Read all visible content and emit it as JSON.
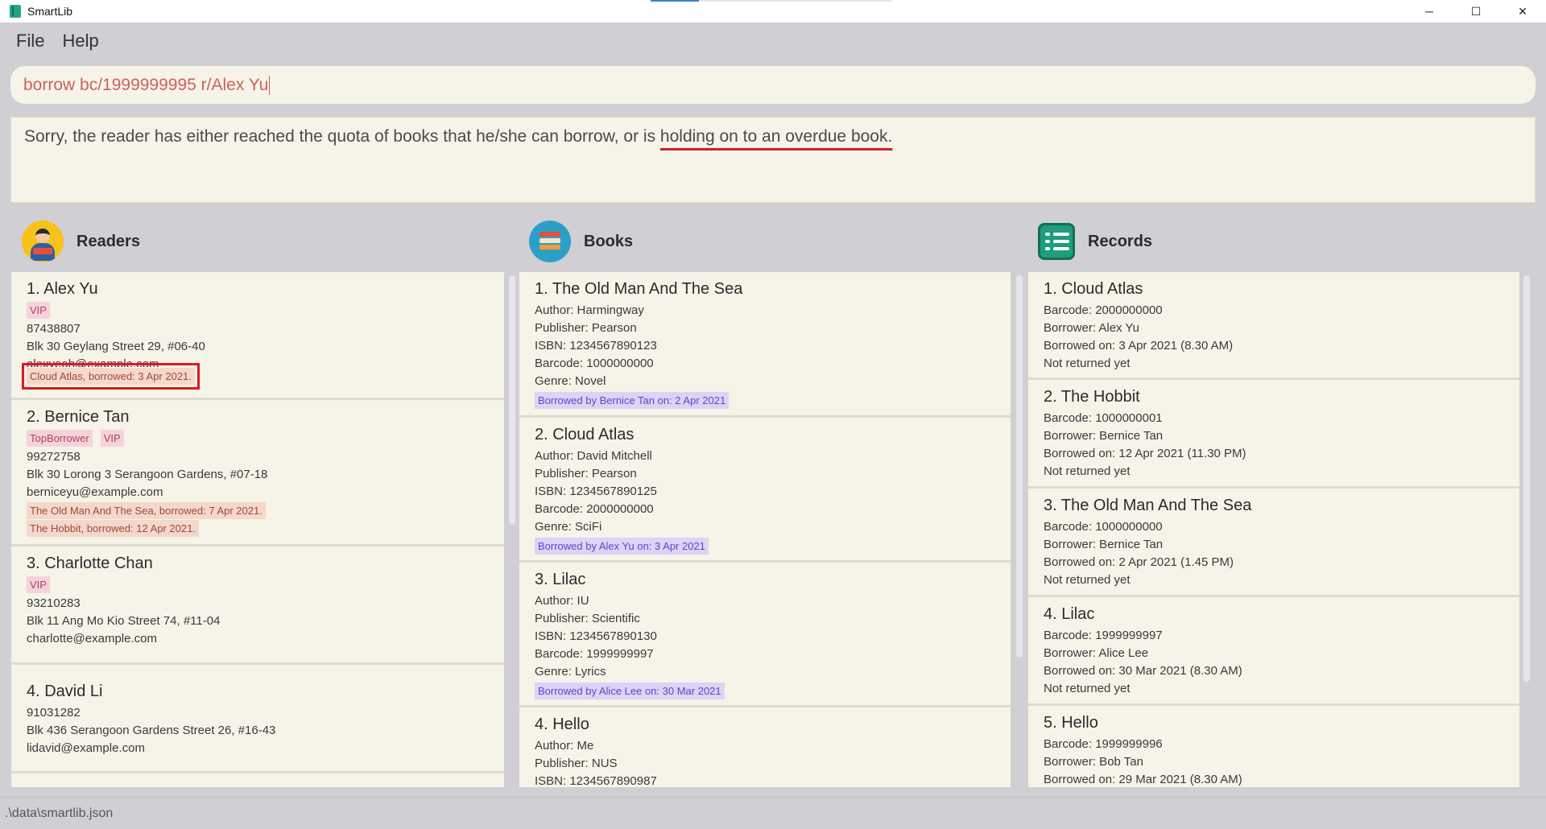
{
  "window": {
    "title": "SmartLib",
    "controls": {
      "minimize": "─",
      "maximize": "☐",
      "close": "✕"
    }
  },
  "menu": {
    "items": [
      "File",
      "Help"
    ]
  },
  "command": {
    "value": "borrow bc/1999999995 r/Alex Yu"
  },
  "result": {
    "text_before": "Sorry, the reader has either reached the quota of books that he/she can borrow, or is ",
    "text_underlined": "holding on to an overdue book."
  },
  "panels": {
    "readers_title": "Readers",
    "books_title": "Books",
    "records_title": "Records"
  },
  "readers": [
    {
      "title": "1.  Alex Yu",
      "tags": [
        "VIP"
      ],
      "phone": "87438807",
      "address": "Blk 30 Geylang Street 29, #06-40",
      "email": "alexyeoh@example.com",
      "loans": [
        "Cloud Atlas, borrowed: 3 Apr 2021."
      ]
    },
    {
      "title": "2.  Bernice Tan",
      "tags": [
        "TopBorrower",
        "VIP"
      ],
      "phone": "99272758",
      "address": "Blk 30 Lorong 3 Serangoon Gardens, #07-18",
      "email": "berniceyu@example.com",
      "loans": [
        "The Old Man And The Sea, borrowed: 7 Apr 2021.",
        "The Hobbit, borrowed: 12 Apr 2021."
      ]
    },
    {
      "title": "3.  Charlotte Chan",
      "tags": [
        "VIP"
      ],
      "phone": "93210283",
      "address": "Blk 11 Ang Mo Kio Street 74, #11-04",
      "email": "charlotte@example.com",
      "loans": []
    },
    {
      "title": "4.  David Li",
      "tags": [],
      "phone": "91031282",
      "address": "Blk 436 Serangoon Gardens Street 26, #16-43",
      "email": "lidavid@example.com",
      "loans": []
    }
  ],
  "books": [
    {
      "title": "1.  The Old Man And The Sea",
      "author": "Author: Harmingway",
      "publisher": "Publisher: Pearson",
      "isbn": "ISBN: 1234567890123",
      "barcode": "Barcode: 1000000000",
      "genre": "Genre: Novel",
      "borrowed": "Borrowed by Bernice Tan on: 2 Apr 2021"
    },
    {
      "title": "2.  Cloud Atlas",
      "author": "Author: David Mitchell",
      "publisher": "Publisher: Pearson",
      "isbn": "ISBN: 1234567890125",
      "barcode": "Barcode: 2000000000",
      "genre": "Genre: SciFi",
      "borrowed": "Borrowed by Alex Yu on: 3 Apr 2021"
    },
    {
      "title": "3.  Lilac",
      "author": "Author: IU",
      "publisher": "Publisher: Scientific",
      "isbn": "ISBN: 1234567890130",
      "barcode": "Barcode: 1999999997",
      "genre": "Genre: Lyrics",
      "borrowed": "Borrowed by Alice Lee on: 30 Mar 2021"
    },
    {
      "title": "4.  Hello",
      "author": "Author: Me",
      "publisher": "Publisher: NUS",
      "isbn": "ISBN: 1234567890987",
      "barcode": "",
      "genre": "",
      "borrowed": ""
    }
  ],
  "records": [
    {
      "title": "1.  Cloud Atlas",
      "barcode": "Barcode: 2000000000",
      "borrower": "Borrower: Alex Yu",
      "borrowed_on": "Borrowed on: 3 Apr 2021 (8.30 AM)",
      "status": "Not returned yet"
    },
    {
      "title": "2.  The Hobbit",
      "barcode": "Barcode: 1000000001",
      "borrower": "Borrower: Bernice Tan",
      "borrowed_on": "Borrowed on: 12 Apr 2021 (11.30 PM)",
      "status": "Not returned yet"
    },
    {
      "title": "3.  The Old Man And The Sea",
      "barcode": "Barcode: 1000000000",
      "borrower": "Borrower: Bernice Tan",
      "borrowed_on": "Borrowed on: 2 Apr 2021 (1.45 PM)",
      "status": "Not returned yet"
    },
    {
      "title": "4.  Lilac",
      "barcode": "Barcode: 1999999997",
      "borrower": "Borrower: Alice Lee",
      "borrowed_on": "Borrowed on: 30 Mar 2021 (8.30 AM)",
      "status": "Not returned yet"
    },
    {
      "title": "5.  Hello",
      "barcode": "Barcode: 1999999996",
      "borrower": "Borrower: Bob Tan",
      "borrowed_on": "Borrowed on: 29 Mar 2021 (8.30 AM)",
      "status": ""
    }
  ],
  "status": {
    "path": ".\\data\\smartlib.json"
  },
  "colors": {
    "accent": "#d0605a",
    "background": "#d0cfd4",
    "card": "#f6f3e9",
    "highlight": "#e0181f"
  }
}
